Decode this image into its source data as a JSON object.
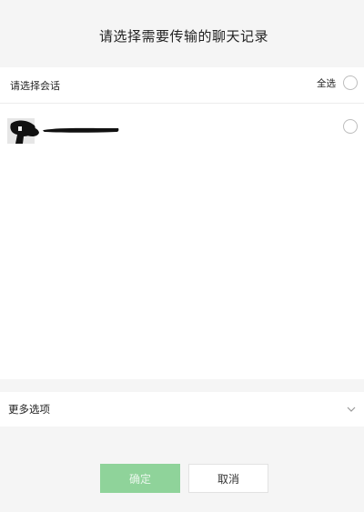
{
  "header": {
    "title": "请选择需要传输的聊天记录"
  },
  "selection": {
    "label": "请选择会话",
    "select_all_label": "全选",
    "select_all_checked": false
  },
  "conversations": [
    {
      "name": "",
      "redacted": true,
      "checked": false
    }
  ],
  "more_options": {
    "label": "更多选项",
    "icon": "chevron-down-icon",
    "expanded": false
  },
  "actions": {
    "confirm_label": "确定",
    "confirm_enabled": false,
    "cancel_label": "取消"
  },
  "colors": {
    "background": "#f5f5f5",
    "panel": "#ffffff",
    "confirm_disabled": "#8fd39a",
    "radio_border": "#bdbdbd"
  }
}
